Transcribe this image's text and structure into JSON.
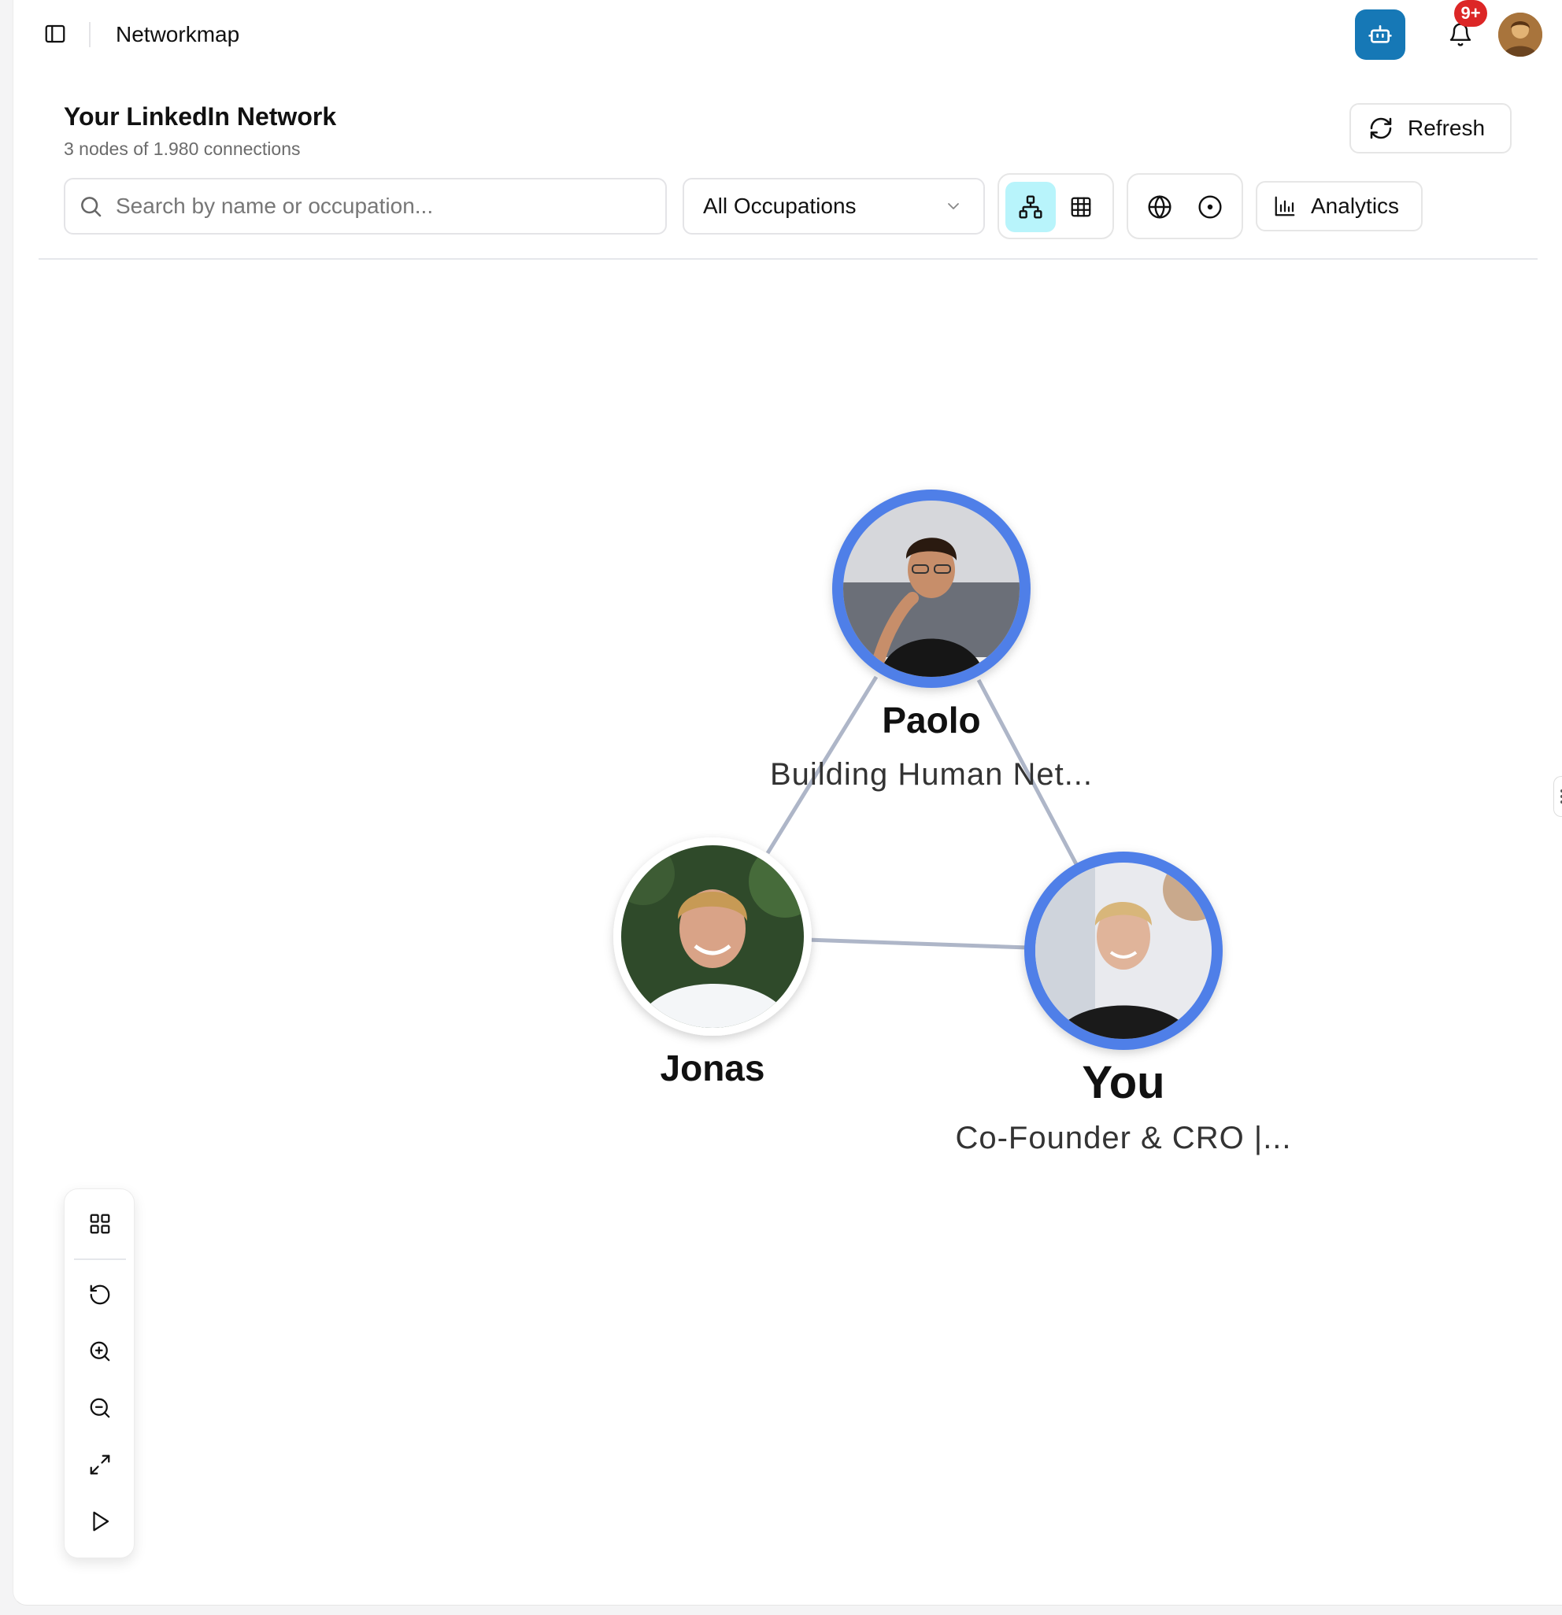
{
  "app": {
    "title": "Networkmap",
    "notification_count": "9+"
  },
  "page": {
    "title": "Your LinkedIn Network",
    "subtitle": "3 nodes of 1.980 connections",
    "refresh_label": "Refresh"
  },
  "toolbar": {
    "search_placeholder": "Search by name or occupation...",
    "search_value": "",
    "occupation_filter": "All Occupations",
    "views": [
      {
        "name": "graph-view",
        "icon": "network-icon",
        "active": true
      },
      {
        "name": "table-view",
        "icon": "grid-icon",
        "active": false
      }
    ],
    "map_modes": [
      {
        "name": "globe-view",
        "icon": "globe-icon"
      },
      {
        "name": "focus-view",
        "icon": "target-icon"
      }
    ],
    "analytics_label": "Analytics"
  },
  "graph": {
    "nodes": [
      {
        "id": "paolo",
        "name": "Paolo",
        "occupation": "Building Human Net...",
        "highlighted": true
      },
      {
        "id": "jonas",
        "name": "Jonas",
        "occupation": "",
        "highlighted": false
      },
      {
        "id": "you",
        "name": "You",
        "occupation": "Co-Founder & CRO |...",
        "highlighted": true
      }
    ],
    "edges": [
      {
        "from": "paolo",
        "to": "jonas"
      },
      {
        "from": "paolo",
        "to": "you"
      },
      {
        "from": "jonas",
        "to": "you"
      }
    ],
    "colors": {
      "highlight_ring": "#4f7fe8",
      "edge": "#aeb6c8",
      "accent": "#1678b6",
      "active_view": "#b8f4fb",
      "badge": "#dc2626"
    }
  },
  "controls": [
    {
      "name": "layout-button",
      "icon": "layout-grid-icon"
    },
    {
      "name": "reset-button",
      "icon": "rotate-ccw-icon"
    },
    {
      "name": "zoom-in-button",
      "icon": "zoom-in-icon"
    },
    {
      "name": "zoom-out-button",
      "icon": "zoom-out-icon"
    },
    {
      "name": "fit-view-button",
      "icon": "expand-icon"
    },
    {
      "name": "play-button",
      "icon": "play-icon"
    }
  ]
}
